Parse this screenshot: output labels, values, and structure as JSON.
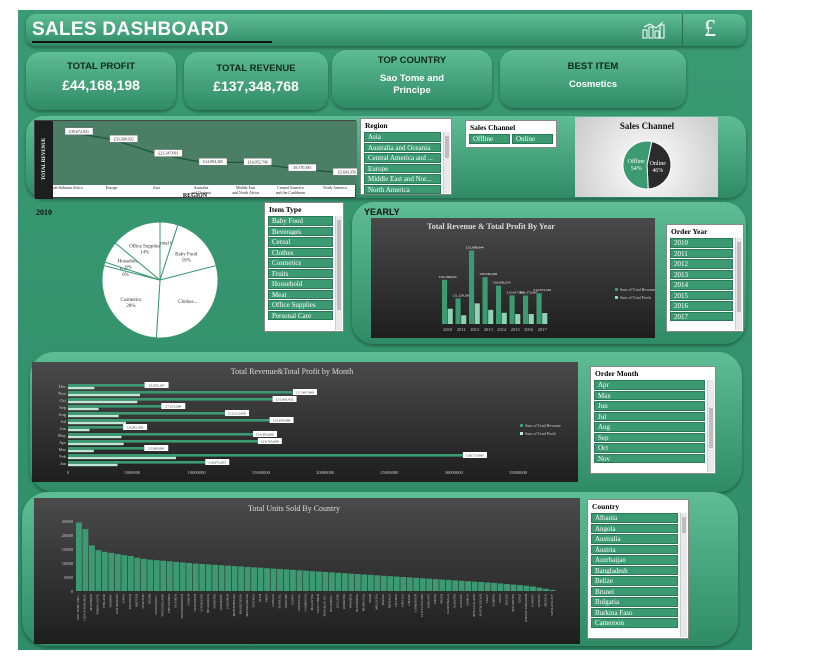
{
  "header": {
    "title": "SALES DASHBOARD",
    "chart_icon": "bar-chart-icon",
    "currency_symbol": "£"
  },
  "kpis": [
    {
      "label": "TOTAL PROFIT",
      "value": "£44,168,198"
    },
    {
      "label": "TOTAL REVENUE",
      "value": "£137,348,768"
    },
    {
      "label": "TOP COUNTRY",
      "value": "Sao Tome and Principe"
    },
    {
      "label": "BEST ITEM",
      "value": "Cosmetics"
    }
  ],
  "slicers": {
    "region": {
      "title": "Region",
      "items": [
        "Asia",
        "Australia and Oceania",
        "Central America and ...",
        "Europe",
        "Middle East and Nor...",
        "North America"
      ]
    },
    "sales_channel": {
      "title": "Sales Channel",
      "items": [
        "Offline",
        "Online"
      ]
    },
    "item_type": {
      "title": "Item Type",
      "items": [
        "Baby Food",
        "Beverages",
        "Cereal",
        "Clothes",
        "Cosmetics",
        "Fruits",
        "Household",
        "Meat",
        "Office Supplies",
        "Personal Care"
      ]
    },
    "order_year": {
      "title": "Order Year",
      "items": [
        "2010",
        "2011",
        "2012",
        "2013",
        "2014",
        "2015",
        "2016",
        "2017"
      ]
    },
    "order_month": {
      "title": "Order Month",
      "items": [
        "Apr",
        "May",
        "Jun",
        "Jul",
        "Aug",
        "Sep",
        "Oct",
        "Nov"
      ]
    },
    "country": {
      "title": "Country",
      "items": [
        "Albania",
        "Angola",
        "Australia",
        "Austria",
        "Azerbaijan",
        "Bangladesh",
        "Belize",
        "Brunei",
        "Bulgaria",
        "Burkina Faso",
        "Cameroon"
      ]
    }
  },
  "labels": {
    "year_2010": "2010",
    "yearly": "YEARLY"
  },
  "chart_data": [
    {
      "id": "region",
      "type": "line",
      "ylabel": "TOTAL REVENUE",
      "xlabel": "REGION",
      "categories": [
        "Sub-Saharan Africa",
        "Europe",
        "Asia",
        "Australia and Oceania",
        "Middle East and North Africa",
        "Central America and the Caribbean",
        "North America"
      ],
      "values": [
        39672031,
        33368932,
        21347091,
        14094265,
        14052706,
        9170385,
        5643356
      ],
      "data_labels": [
        "£39,672,031",
        "£33,368,932",
        "£21,347,091",
        "£14,094,265",
        "£14,052,706",
        "£9,170,385",
        "£5,643,356"
      ]
    },
    {
      "id": "sales_channel",
      "type": "pie",
      "title": "Sales Channel",
      "slices": [
        {
          "name": "Online",
          "label": "Online",
          "pct": "46%",
          "value": 46
        },
        {
          "name": "Offline",
          "label": "Offline",
          "pct": "54%",
          "value": 54
        }
      ]
    },
    {
      "id": "item_pie",
      "type": "pie",
      "slices": [
        {
          "name": "Personal Care",
          "pct": "",
          "value": 5
        },
        {
          "name": "Baby Food",
          "pct": "16%",
          "value": 16
        },
        {
          "name": "Clothes",
          "pct": "",
          "value": 30
        },
        {
          "name": "Cosmetics",
          "pct": "28%",
          "value": 28
        },
        {
          "name": "Fruits",
          "pct": "0%",
          "value": 1
        },
        {
          "name": "Household",
          "pct": "6%",
          "value": 6
        },
        {
          "name": "Office Supplies",
          "pct": "14%",
          "value": 14
        }
      ]
    },
    {
      "id": "yearly",
      "type": "bar",
      "title": "Total Revenue & Total Profit By Year",
      "categories": [
        "2010",
        "2011",
        "2012",
        "2013",
        "2014",
        "2015",
        "2016",
        "2017"
      ],
      "series": [
        {
          "name": "Sum of Total Revenue",
          "values": [
            19186024,
            11129166,
            31898644,
            20330448,
            16630214,
            12427983,
            12372867,
            13373419
          ]
        },
        {
          "name": "Sum of Total Profit",
          "values": [
            6629482,
            3785861,
            8955213,
            6131891,
            4869003,
            4320418,
            4323211,
            4758093
          ]
        }
      ],
      "data_labels": [
        "£19,186,024",
        "£11,129,166",
        "£31,898,644",
        "£20,330,448",
        "£16,630,214",
        "£12,427,983",
        "£12,372,867",
        "£13,373,419"
      ]
    },
    {
      "id": "monthly",
      "type": "bar",
      "title": "Total Revenue&Total Profit by Month",
      "categories": [
        "Jan",
        "Feb",
        "Mar",
        "Apr",
        "May",
        "Jun",
        "Jul",
        "Aug",
        "Sep",
        "Oct",
        "Nov",
        "Dec"
      ],
      "series": [
        {
          "name": "Sum of Total Revenue",
          "values": [
            10675055,
            30717685,
            5928830,
            14765608,
            14392660,
            4285356,
            15678980,
            12213459,
            7253298,
            15910932,
            17497499,
            5955187
          ]
        },
        {
          "name": "Sum of Total Profit",
          "values": [
            3850000,
            8400000,
            2010000,
            4330000,
            4160000,
            1670000,
            4510000,
            3940000,
            2380000,
            5390000,
            5600000,
            2050000
          ]
        }
      ],
      "data_labels": [
        "£10,675,055",
        "£30,717,685",
        "£5,928,830",
        "£14,765,608",
        "£14,392,660",
        "£4,285,356",
        "£15,678,980",
        "£12,213,459",
        "£7,253,298",
        "£15,910,932",
        "£17,497,499",
        "£5,955,187"
      ],
      "xticks": [
        "0",
        "5000000",
        "10000000",
        "15000000",
        "20000000",
        "25000000",
        "30000000",
        "35000000"
      ]
    },
    {
      "id": "country",
      "type": "bar",
      "title": "Total Units Sold By Country",
      "yticks": [
        "0",
        "5000",
        "10000",
        "15000",
        "20000",
        "25000"
      ],
      "categories": [
        "SAO TOME AND...",
        "CZECH REPUBLIC",
        "MYANMAR",
        "TIMOR-LESTE",
        "FINLAND",
        "NORWAY",
        "SAN MARINO",
        "LIBYA",
        "PAKISTAN",
        "BHUTAN",
        "LESOTHO",
        "BENIN",
        "FEDERATED...",
        "SWITZERLAND",
        "PHILIPPINES",
        "UGANDA",
        "TURKMENISTAN",
        "GABON",
        "TAJIKISTAN",
        "LITHUANIA",
        "NICARAGUA",
        "BURUNDI",
        "GERMANY",
        "LEBANON",
        "MONTENEGRO",
        "MAURITANIA",
        "MADAGASCAR",
        "ERITREA",
        "IRAN",
        "PERU",
        "LIBERIA",
        "SENEGAL",
        "UKRAINE",
        "KENYA",
        "PORTUGAL",
        "CAMBODIA",
        "MALAYSIA",
        "EAST TIMOR",
        "REPUBLIC OF...",
        "SOLOMON...",
        "ICELAND",
        "ROMANIA",
        "RWANDA",
        "BOTSWANA",
        "MONGOLIA",
        "SPAIN",
        "MOLDOVA",
        "SERBIA",
        "MONACO",
        "FRANCE",
        "ANGOLA",
        "GHANA",
        "CAMEROON",
        "COTE D'IVOIRE",
        "DJIBOUTI",
        "CHINA",
        "NIGER",
        "GUATEMALA",
        "ALBANIA",
        "AUSTRIA",
        "SAMOA",
        "NEW ZEALAND",
        "SOUTH SUDAN",
        "ITALY",
        "ZAMBIA",
        "HAITI",
        "BELIZE",
        "MAURITIUS",
        "CHAD",
        "UNITED KINGDOM",
        "KUWAIT",
        "KOSOVO",
        "MEXICO",
        "VATICAN CITY"
      ],
      "values": [
        24450,
        22100,
        16300,
        14600,
        14000,
        13600,
        13200,
        12800,
        12500,
        11900,
        11500,
        11200,
        11000,
        10800,
        10600,
        10400,
        10200,
        10000,
        9800,
        9650,
        9500,
        9350,
        9200,
        9050,
        8900,
        8750,
        8600,
        8450,
        8300,
        8150,
        8000,
        7850,
        7700,
        7550,
        7400,
        7250,
        7100,
        6950,
        6800,
        6650,
        6500,
        6350,
        6200,
        6050,
        5900,
        5750,
        5600,
        5450,
        5300,
        5150,
        5000,
        4850,
        4700,
        4550,
        4400,
        4250,
        4100,
        3950,
        3800,
        3650,
        3500,
        3350,
        3200,
        3050,
        2900,
        2700,
        2500,
        2300,
        2100,
        1900,
        1600,
        1200,
        800,
        400
      ]
    }
  ]
}
